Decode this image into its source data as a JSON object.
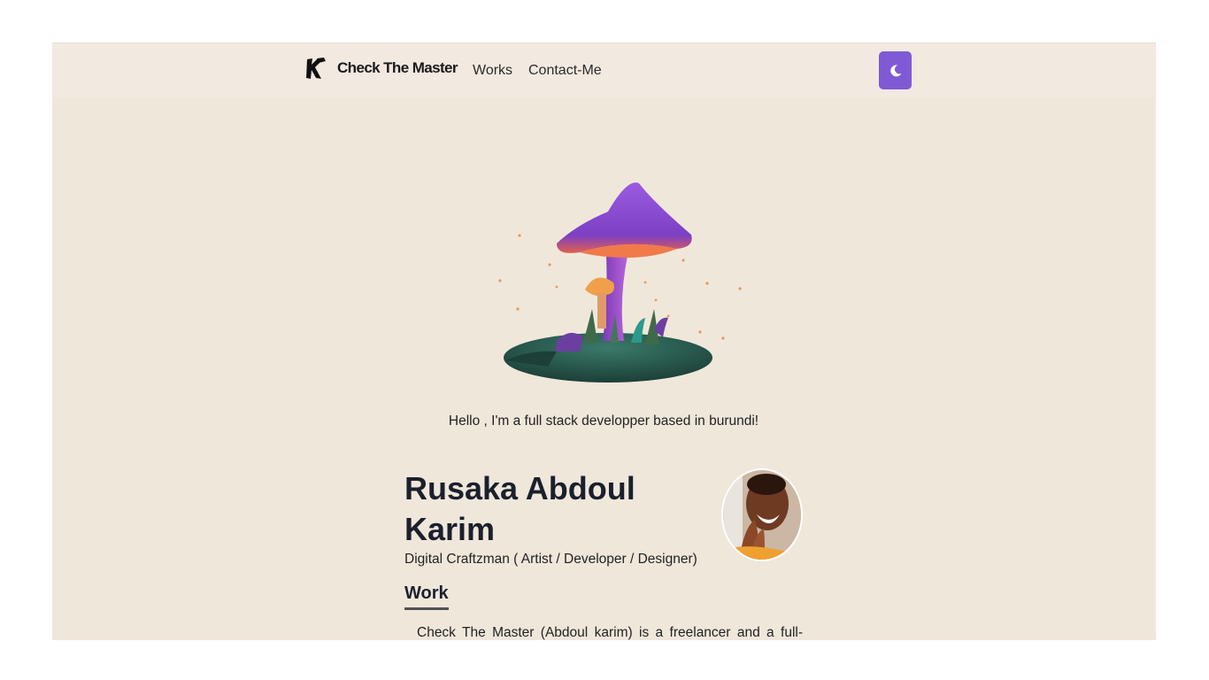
{
  "navbar": {
    "brand": "Check The Master",
    "links": [
      "Works",
      "Contact-Me"
    ],
    "theme_toggle_icon": "moon-icon",
    "accent_color": "#805ad5"
  },
  "hero": {
    "illustration": "mushroom-illustration",
    "greeting": "Hello , I'm a full stack developper based in burundi!"
  },
  "profile": {
    "name": "Rusaka Abdoul Karim",
    "tagline": "Digital Craftzman ( Artist / Developer / Designer)",
    "avatar": "avatar"
  },
  "work": {
    "title": "Work",
    "paragraph": "Check The Master (Abdoul karim) is a freelancer and a full-stack"
  },
  "colors": {
    "page_background": "#f0e7db",
    "text": "#1a202c"
  }
}
